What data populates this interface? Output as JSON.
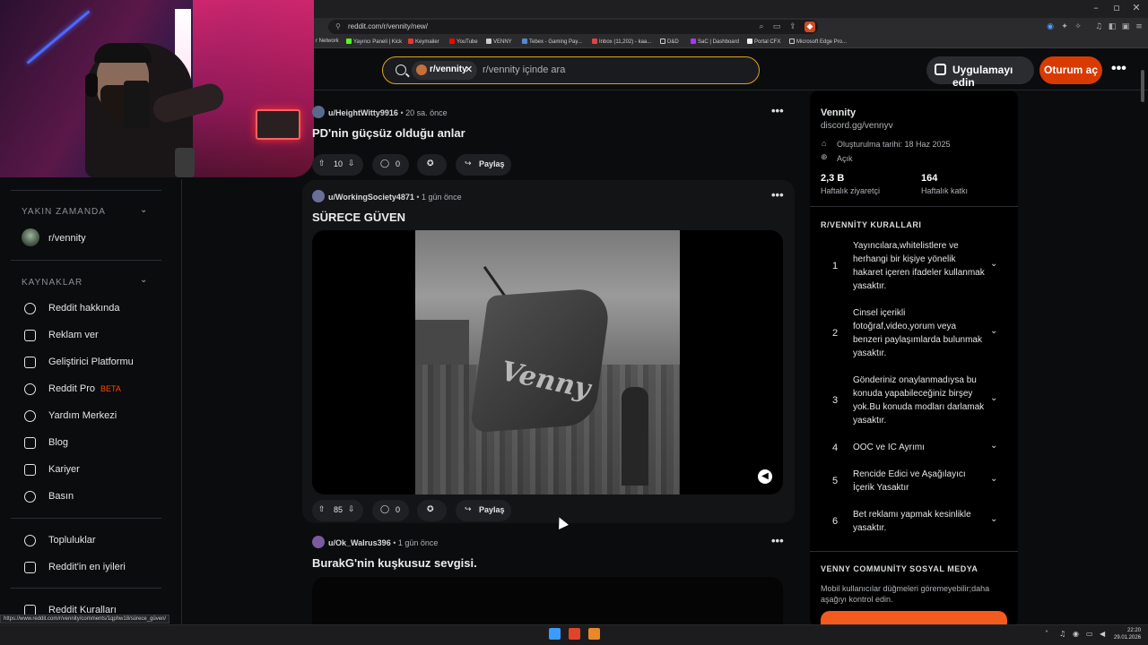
{
  "browser": {
    "url": "reddit.com/r/vennity/new/",
    "status_url": "https://www.reddit.com/r/vennity/comments/1qphw18/sürece_güven/",
    "bookmarks": [
      "r Network",
      "Yayıncı Paneli | Kick",
      "Keymailer",
      "YouTube",
      "VENNY",
      "Tebex - Gaming Pay...",
      "Inbox (11,202) - kaa...",
      "D&D",
      "SaC | Dashboard",
      "Portal CFX",
      "Microsoft Edge Pro..."
    ]
  },
  "header": {
    "chip_label": "r/vennity",
    "search_placeholder": "r/vennity içinde ara",
    "app_button": "Uygulamayı edin",
    "login_button": "Oturum aç"
  },
  "sidebar": {
    "recent_title": "YAKIN ZAMANDA",
    "recent_item": "r/vennity",
    "resources_title": "KAYNAKLAR",
    "resources": [
      "Reddit hakkında",
      "Reklam ver",
      "Geliştirici Platformu",
      "Reddit Pro",
      "Yardım Merkezi",
      "Blog",
      "Kariyer",
      "Basın"
    ],
    "beta_label": "BETA",
    "communities": [
      "Topluluklar",
      "Reddit'in en iyileri"
    ],
    "rules": "Reddit Kuralları"
  },
  "posts": [
    {
      "author": "u/HeightWitty9916",
      "time": "20 sa. önce",
      "title": "PD'nin güçsüz olduğu anlar",
      "votes": "10",
      "comments": "0",
      "share": "Paylaş"
    },
    {
      "author": "u/WorkingSociety4871",
      "time": "1 gün önce",
      "title": "SÜRECE GÜVEN",
      "votes": "85",
      "comments": "0",
      "share": "Paylaş",
      "image_text": "Venny"
    },
    {
      "author": "u/Ok_Walrus396",
      "time": "1 gün önce",
      "title": "BurakG'nin kuşkusuz sevgisi."
    }
  ],
  "community": {
    "name": "Vennity",
    "link": "discord.gg/vennyv",
    "created": "Oluşturulma tarihi: 18 Haz 2025",
    "visibility": "Açık",
    "visitors_value": "2,3 B",
    "visitors_label": "Haftalık ziyaretçi",
    "contrib_value": "164",
    "contrib_label": "Haftalık katkı",
    "rules_title": "R/VENNİTY KURALLARI",
    "rules": [
      {
        "n": "1",
        "text": "Yayıncılara,whitelistlere ve herhangi bir kişiye yönelik hakaret içeren ifadeler kullanmak yasaktır."
      },
      {
        "n": "2",
        "text": "Cinsel içerikli fotoğraf,video,yorum veya benzeri paylaşımlarda bulunmak yasaktır."
      },
      {
        "n": "3",
        "text": "Gönderiniz onaylanmadıysa bu konuda yapabileceğiniz birşey yok.Bu konuda modları darlamak yasaktır."
      },
      {
        "n": "4",
        "text": "OOC ve IC Ayrımı"
      },
      {
        "n": "5",
        "text": "Rencide Edici ve Aşağılayıcı İçerik Yasaktır"
      },
      {
        "n": "6",
        "text": "Bet reklamı yapmak kesinlikle yasaktır."
      }
    ],
    "social_title": "VENNY COMMUNİTY SOSYAL MEDYA",
    "social_desc": "Mobil kullanıcılar düğmeleri göremeyebilir;daha aşağıyı kontrol edin."
  },
  "taskbar": {
    "time": "22:20",
    "date": "29.01.2026"
  }
}
